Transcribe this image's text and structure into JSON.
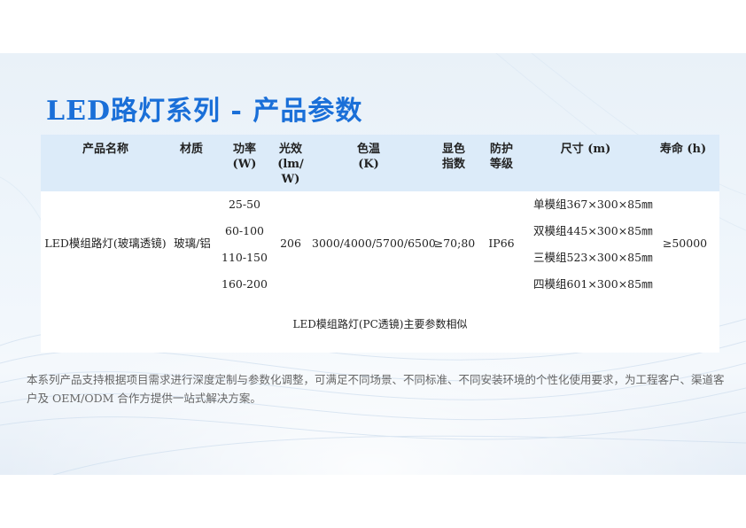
{
  "title": "LED路灯系列 - 产品参数",
  "table": {
    "headers": {
      "name": "产品名称",
      "material": "材质",
      "power": "功率\n(W)",
      "efficacy": "光效\n(lm/\nW)",
      "cct": "色温\n(K)",
      "cri": "显色\n指数",
      "ip": "防护\n等级",
      "size": "尺寸 (m)",
      "life": "寿命 (h)"
    },
    "row": {
      "name": "LED模组路灯(玻璃透镜)",
      "material": "玻璃/铝",
      "powers": [
        "25-50",
        "60-100",
        "110-150",
        "160-200"
      ],
      "efficacy": "206",
      "cct": "3000/4000/5700/6500",
      "cri": "≥70;80",
      "ip": "IP66",
      "sizes": [
        "单模组367×300×85㎜",
        "双模组445×300×85㎜",
        "三模组523×300×85㎜",
        "四模组601×300×85㎜"
      ],
      "life": "≥50000"
    },
    "note": "LED模组路灯(PC透镜)主要参数相似"
  },
  "description_line1": "本系列产品支持根据项目需求进行深度定制与参数化调整，可满足不同场景、不同标准、不同安装环境的个性化使用要求，为工程客户、渠道客",
  "description_line2": "户及 OEM/ODM 合作方提供一站式解决方案。"
}
